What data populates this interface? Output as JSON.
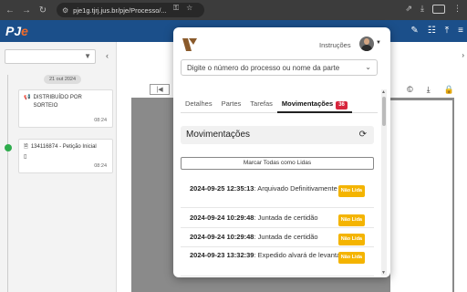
{
  "browser": {
    "url": "pje1g.tjrj.jus.br/pje/Processo/...",
    "back_icon": "←",
    "forward_icon": "→",
    "reload_icon": "↻"
  },
  "pje": {
    "logo_text": "PJ",
    "logo_accent": "e"
  },
  "left_panel": {
    "date_label": "21 out 2024",
    "cards": [
      {
        "title": "DISTRIBUÍDO POR SORTEIO",
        "time": "08:24"
      },
      {
        "title": "134116874 - Petição Inicial",
        "time": "08:24"
      }
    ]
  },
  "popup": {
    "instructions": "Instruções",
    "process_placeholder": "Digite o número do processo ou nome da parte",
    "tabs": [
      {
        "label": "Detalhes"
      },
      {
        "label": "Partes"
      },
      {
        "label": "Tarefas"
      },
      {
        "label": "Movimentações",
        "badge": "36"
      }
    ],
    "panel_title": "Movimentações",
    "mark_all_button": "Marcar Todas como Lidas",
    "unread_label": "Não Lida",
    "movements": [
      {
        "datetime": "2024-09-25 12:35:13",
        "text": ": Arquivado Definitivamente",
        "status": "Não Lida"
      },
      {
        "datetime": "2024-09-24 10:29:48",
        "text": ": Juntada de certidão",
        "status": "Não Lida"
      },
      {
        "datetime": "2024-09-24 10:29:48",
        "text": ": Juntada de certidão",
        "status": "Não Lida"
      },
      {
        "datetime": "2024-09-23 13:32:39",
        "text": ": Expedido alvará de levantamento",
        "status": "Não Lida"
      }
    ]
  },
  "colors": {
    "pje_header": "#1b4f8a",
    "badge": "#d7263d",
    "unread": "#f4b400",
    "timeline_dot": "#2eac4c"
  }
}
